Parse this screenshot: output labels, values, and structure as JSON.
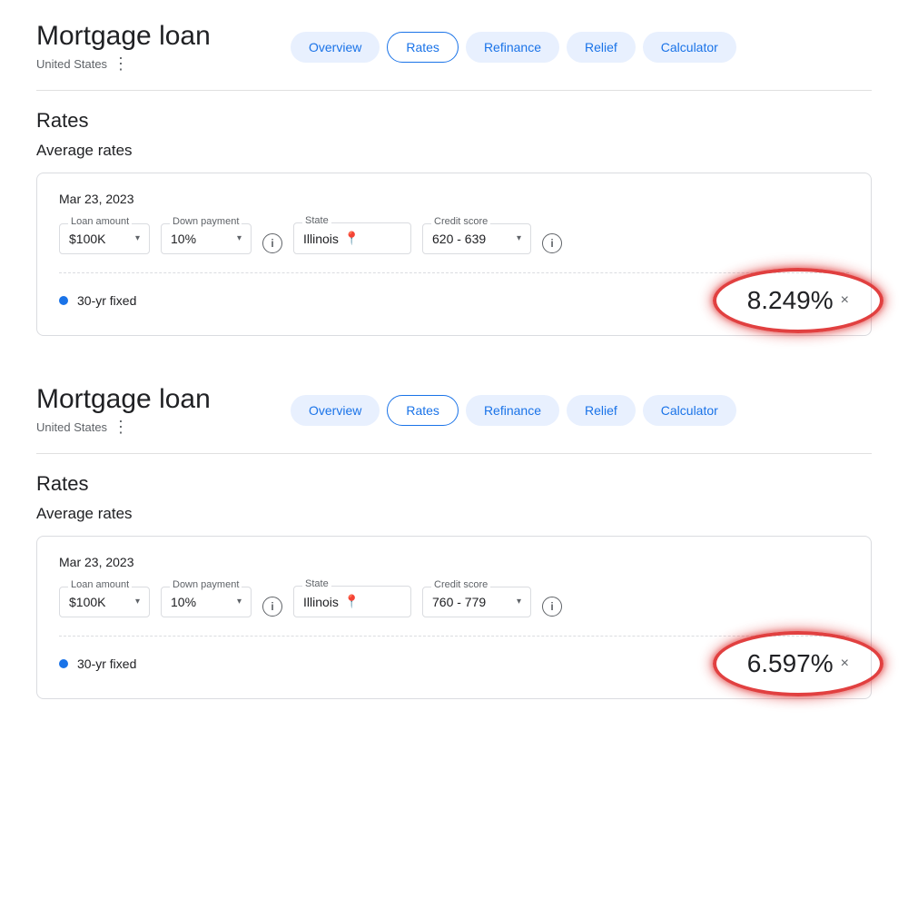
{
  "sections": [
    {
      "id": "section1",
      "header": {
        "title": "Mortgage loan",
        "subtitle": "United States"
      },
      "nav": {
        "tabs": [
          {
            "label": "Overview",
            "active": false
          },
          {
            "label": "Rates",
            "active": true
          },
          {
            "label": "Refinance",
            "active": false
          },
          {
            "label": "Relief",
            "active": false
          },
          {
            "label": "Calculator",
            "active": false
          }
        ]
      },
      "rates": {
        "title": "Rates",
        "avg_title": "Average rates",
        "card": {
          "date": "Mar 23, 2023",
          "filters": {
            "loan_amount": {
              "label": "Loan amount",
              "value": "$100K"
            },
            "down_payment": {
              "label": "Down payment",
              "value": "10%"
            },
            "state": {
              "label": "State",
              "value": "Illinois"
            },
            "credit_score": {
              "label": "Credit score",
              "value": "620 - 639"
            }
          },
          "rate_row": {
            "label": "30-yr fixed",
            "value": "8.249%"
          }
        }
      }
    },
    {
      "id": "section2",
      "header": {
        "title": "Mortgage loan",
        "subtitle": "United States"
      },
      "nav": {
        "tabs": [
          {
            "label": "Overview",
            "active": false
          },
          {
            "label": "Rates",
            "active": true
          },
          {
            "label": "Refinance",
            "active": false
          },
          {
            "label": "Relief",
            "active": false
          },
          {
            "label": "Calculator",
            "active": false
          }
        ]
      },
      "rates": {
        "title": "Rates",
        "avg_title": "Average rates",
        "card": {
          "date": "Mar 23, 2023",
          "filters": {
            "loan_amount": {
              "label": "Loan amount",
              "value": "$100K"
            },
            "down_payment": {
              "label": "Down payment",
              "value": "10%"
            },
            "state": {
              "label": "State",
              "value": "Illinois"
            },
            "credit_score": {
              "label": "Credit score",
              "value": "760 - 779"
            }
          },
          "rate_row": {
            "label": "30-yr fixed",
            "value": "6.597%"
          }
        }
      }
    }
  ],
  "icons": {
    "chevron": "▾",
    "info": "i",
    "pin": "📍",
    "close": "×",
    "dots": "⋮"
  }
}
